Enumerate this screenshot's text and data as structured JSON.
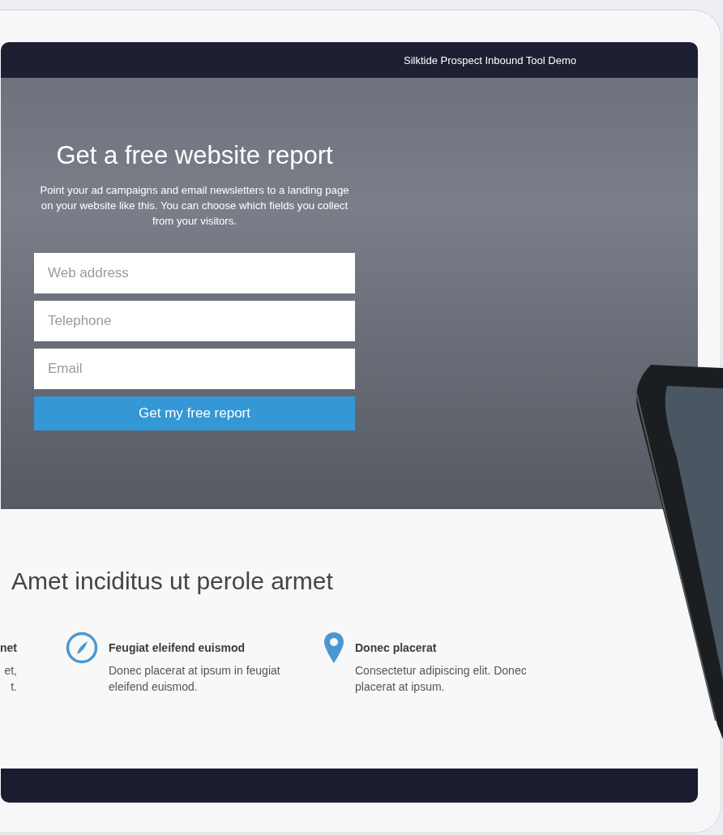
{
  "top_bar": {
    "title": "Silktide Prospect Inbound Tool Demo"
  },
  "hero": {
    "title": "Get a free website report",
    "description": "Point your ad campaigns and email newsletters to a landing page on your website like this. You can choose which fields you collect from your visitors.",
    "fields": [
      {
        "placeholder": "Web address"
      },
      {
        "placeholder": "Telephone"
      },
      {
        "placeholder": "Email"
      }
    ],
    "button": "Get my free report"
  },
  "features_section": {
    "heading": "Amet inciditus ut perole armet",
    "features": [
      {
        "kind": "cut",
        "title": "net",
        "description": [
          "et,",
          "t."
        ]
      },
      {
        "kind": "compass",
        "title": "Feugiat eleifend euismod",
        "description": [
          "Donec placerat at ipsum in feugiat",
          "eleifend euismod."
        ]
      },
      {
        "kind": "pin",
        "title": "Donec placerat",
        "description": [
          "Consectetur adipiscing elit. Donec",
          "placerat at ipsum."
        ]
      }
    ]
  }
}
